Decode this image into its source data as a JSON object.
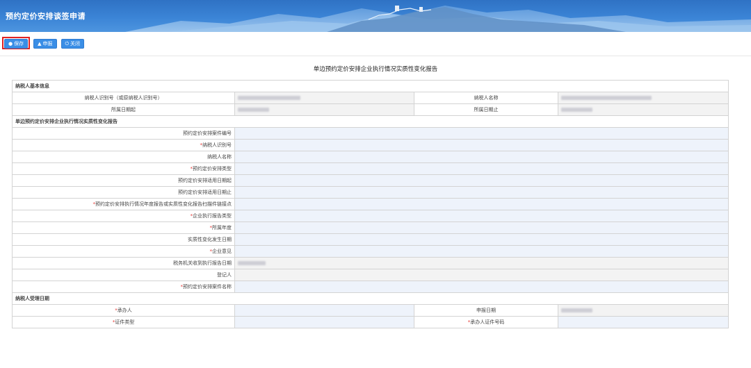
{
  "header": {
    "title": "预约定价安排谈签申请"
  },
  "toolbar": {
    "save_label": "保存",
    "submit_label": "申报",
    "close_label": "关闭"
  },
  "report_title": "单边预约定价安排企业执行情况实质性变化报告",
  "basic_info": {
    "section_title": "纳税人基本信息",
    "rows": [
      {
        "label1": "纳税人识别号（或原纳税人识别号）",
        "label2": "纳税人名称"
      },
      {
        "label1": "所属日期起",
        "label2": "所属日期止"
      }
    ]
  },
  "report_section": {
    "section_title": "单边预约定价安排企业执行情况实质性变化报告",
    "fields": [
      {
        "label": "预约定价安排案件编号",
        "required": ""
      },
      {
        "label": "纳税人识别号",
        "required": "*"
      },
      {
        "label": "纳税人名称",
        "required": ""
      },
      {
        "label": "预约定价安排类型",
        "required": "*"
      },
      {
        "label": "预约定价安排适用日期起",
        "required": ""
      },
      {
        "label": "预约定价安排适用日期止",
        "required": ""
      },
      {
        "label": "预约定价安排执行情况年度报告或实质性变化报告扫描件链接点",
        "required": "*"
      },
      {
        "label": "企业执行报告类型",
        "required": "*"
      },
      {
        "label": "所属年度",
        "required": "*"
      },
      {
        "label": "实质性变化发生日期",
        "required": ""
      },
      {
        "label": "企业意见",
        "required": "*"
      },
      {
        "label": "税务机关收到执行报告日期",
        "required": ""
      },
      {
        "label": "登记人",
        "required": ""
      },
      {
        "label": "预约定价安排案件名称",
        "required": "*"
      }
    ]
  },
  "acceptance": {
    "section_title": "纳税人受理日期",
    "rows": [
      {
        "req1": "*",
        "label1": "承办人",
        "req2": "",
        "label2": "申报日期"
      },
      {
        "req1": "*",
        "label1": "证件类型",
        "req2": "*",
        "label2": "承办人证件号码"
      }
    ]
  },
  "colors": {
    "header_blue": "#3b84d6",
    "button_blue": "#3a8ee6",
    "highlight_red": "#e02020",
    "required_red": "#e53935",
    "input_bg": "#eef3fb"
  }
}
